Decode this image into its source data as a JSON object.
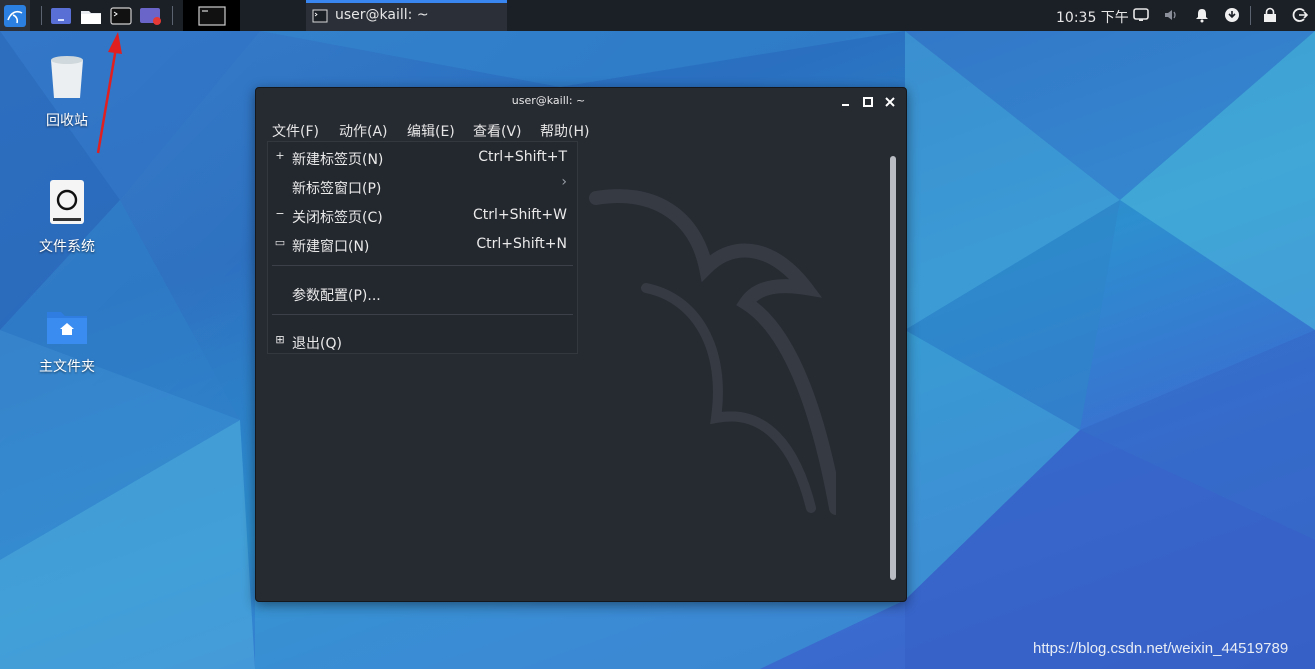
{
  "colors": {
    "panel_bg": "#1b1f26",
    "accent": "#3a86f0",
    "window_bg": "#262a31",
    "menu_bg": "#23272e"
  },
  "panel": {
    "launchers": [
      {
        "icon": "kali-menu-icon"
      },
      {
        "icon": "show-desktop-icon"
      },
      {
        "icon": "file-manager-icon"
      },
      {
        "icon": "terminal-icon"
      },
      {
        "icon": "screen-recorder-icon"
      }
    ],
    "workspace_icon": "terminal-icon",
    "task_title": "user@kaill: ~",
    "clock": "10:35 下午",
    "tray": [
      "display-icon",
      "volume-icon",
      "notification-bell-icon",
      "update-icon",
      "lock-icon",
      "logout-icon"
    ]
  },
  "desktop": {
    "icons": [
      {
        "label": "回收站",
        "icon": "trash-icon"
      },
      {
        "label": "文件系统",
        "icon": "drive-icon"
      },
      {
        "label": "主文件夹",
        "icon": "home-folder-icon"
      }
    ]
  },
  "window": {
    "title": "user@kaill: ~",
    "controls": [
      "minimize-icon",
      "maximize-icon",
      "close-icon"
    ],
    "menu": [
      {
        "label": "文件(F)"
      },
      {
        "label": "动作(A)"
      },
      {
        "label": "编辑(E)"
      },
      {
        "label": "查看(V)"
      },
      {
        "label": "帮助(H)"
      }
    ]
  },
  "file_menu": {
    "items": [
      {
        "label": "新建标签页(N)",
        "accel": "Ctrl+Shift+T",
        "icon": "+"
      },
      {
        "label": "新标签窗口(P)",
        "accel": "›",
        "icon": ""
      },
      {
        "label": "关闭标签页(C)",
        "accel": "Ctrl+Shift+W",
        "icon": "−"
      },
      {
        "label": "新建窗口(N)",
        "accel": "Ctrl+Shift+N",
        "icon": "▭"
      },
      {
        "label": "参数配置(P)...",
        "accel": "",
        "icon": ""
      },
      {
        "label": "退出(Q)",
        "accel": "",
        "icon": "⊞"
      }
    ]
  },
  "watermark": "https://blog.csdn.net/weixin_44519789"
}
